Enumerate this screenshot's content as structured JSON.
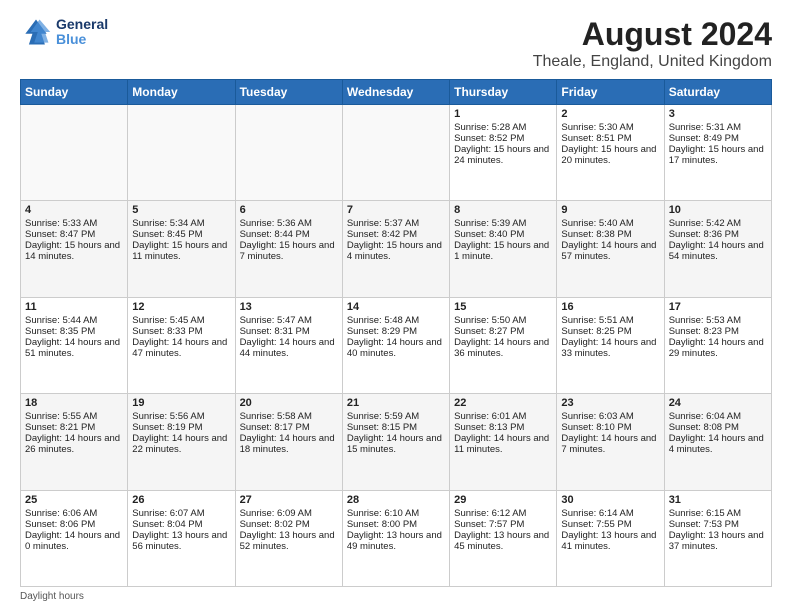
{
  "logo": {
    "line1": "General",
    "line2": "Blue"
  },
  "title": "August 2024",
  "subtitle": "Theale, England, United Kingdom",
  "days_of_week": [
    "Sunday",
    "Monday",
    "Tuesday",
    "Wednesday",
    "Thursday",
    "Friday",
    "Saturday"
  ],
  "footer": "Daylight hours",
  "weeks": [
    [
      {
        "day": "",
        "sunrise": "",
        "sunset": "",
        "daylight": ""
      },
      {
        "day": "",
        "sunrise": "",
        "sunset": "",
        "daylight": ""
      },
      {
        "day": "",
        "sunrise": "",
        "sunset": "",
        "daylight": ""
      },
      {
        "day": "",
        "sunrise": "",
        "sunset": "",
        "daylight": ""
      },
      {
        "day": "1",
        "sunrise": "Sunrise: 5:28 AM",
        "sunset": "Sunset: 8:52 PM",
        "daylight": "Daylight: 15 hours and 24 minutes."
      },
      {
        "day": "2",
        "sunrise": "Sunrise: 5:30 AM",
        "sunset": "Sunset: 8:51 PM",
        "daylight": "Daylight: 15 hours and 20 minutes."
      },
      {
        "day": "3",
        "sunrise": "Sunrise: 5:31 AM",
        "sunset": "Sunset: 8:49 PM",
        "daylight": "Daylight: 15 hours and 17 minutes."
      }
    ],
    [
      {
        "day": "4",
        "sunrise": "Sunrise: 5:33 AM",
        "sunset": "Sunset: 8:47 PM",
        "daylight": "Daylight: 15 hours and 14 minutes."
      },
      {
        "day": "5",
        "sunrise": "Sunrise: 5:34 AM",
        "sunset": "Sunset: 8:45 PM",
        "daylight": "Daylight: 15 hours and 11 minutes."
      },
      {
        "day": "6",
        "sunrise": "Sunrise: 5:36 AM",
        "sunset": "Sunset: 8:44 PM",
        "daylight": "Daylight: 15 hours and 7 minutes."
      },
      {
        "day": "7",
        "sunrise": "Sunrise: 5:37 AM",
        "sunset": "Sunset: 8:42 PM",
        "daylight": "Daylight: 15 hours and 4 minutes."
      },
      {
        "day": "8",
        "sunrise": "Sunrise: 5:39 AM",
        "sunset": "Sunset: 8:40 PM",
        "daylight": "Daylight: 15 hours and 1 minute."
      },
      {
        "day": "9",
        "sunrise": "Sunrise: 5:40 AM",
        "sunset": "Sunset: 8:38 PM",
        "daylight": "Daylight: 14 hours and 57 minutes."
      },
      {
        "day": "10",
        "sunrise": "Sunrise: 5:42 AM",
        "sunset": "Sunset: 8:36 PM",
        "daylight": "Daylight: 14 hours and 54 minutes."
      }
    ],
    [
      {
        "day": "11",
        "sunrise": "Sunrise: 5:44 AM",
        "sunset": "Sunset: 8:35 PM",
        "daylight": "Daylight: 14 hours and 51 minutes."
      },
      {
        "day": "12",
        "sunrise": "Sunrise: 5:45 AM",
        "sunset": "Sunset: 8:33 PM",
        "daylight": "Daylight: 14 hours and 47 minutes."
      },
      {
        "day": "13",
        "sunrise": "Sunrise: 5:47 AM",
        "sunset": "Sunset: 8:31 PM",
        "daylight": "Daylight: 14 hours and 44 minutes."
      },
      {
        "day": "14",
        "sunrise": "Sunrise: 5:48 AM",
        "sunset": "Sunset: 8:29 PM",
        "daylight": "Daylight: 14 hours and 40 minutes."
      },
      {
        "day": "15",
        "sunrise": "Sunrise: 5:50 AM",
        "sunset": "Sunset: 8:27 PM",
        "daylight": "Daylight: 14 hours and 36 minutes."
      },
      {
        "day": "16",
        "sunrise": "Sunrise: 5:51 AM",
        "sunset": "Sunset: 8:25 PM",
        "daylight": "Daylight: 14 hours and 33 minutes."
      },
      {
        "day": "17",
        "sunrise": "Sunrise: 5:53 AM",
        "sunset": "Sunset: 8:23 PM",
        "daylight": "Daylight: 14 hours and 29 minutes."
      }
    ],
    [
      {
        "day": "18",
        "sunrise": "Sunrise: 5:55 AM",
        "sunset": "Sunset: 8:21 PM",
        "daylight": "Daylight: 14 hours and 26 minutes."
      },
      {
        "day": "19",
        "sunrise": "Sunrise: 5:56 AM",
        "sunset": "Sunset: 8:19 PM",
        "daylight": "Daylight: 14 hours and 22 minutes."
      },
      {
        "day": "20",
        "sunrise": "Sunrise: 5:58 AM",
        "sunset": "Sunset: 8:17 PM",
        "daylight": "Daylight: 14 hours and 18 minutes."
      },
      {
        "day": "21",
        "sunrise": "Sunrise: 5:59 AM",
        "sunset": "Sunset: 8:15 PM",
        "daylight": "Daylight: 14 hours and 15 minutes."
      },
      {
        "day": "22",
        "sunrise": "Sunrise: 6:01 AM",
        "sunset": "Sunset: 8:13 PM",
        "daylight": "Daylight: 14 hours and 11 minutes."
      },
      {
        "day": "23",
        "sunrise": "Sunrise: 6:03 AM",
        "sunset": "Sunset: 8:10 PM",
        "daylight": "Daylight: 14 hours and 7 minutes."
      },
      {
        "day": "24",
        "sunrise": "Sunrise: 6:04 AM",
        "sunset": "Sunset: 8:08 PM",
        "daylight": "Daylight: 14 hours and 4 minutes."
      }
    ],
    [
      {
        "day": "25",
        "sunrise": "Sunrise: 6:06 AM",
        "sunset": "Sunset: 8:06 PM",
        "daylight": "Daylight: 14 hours and 0 minutes."
      },
      {
        "day": "26",
        "sunrise": "Sunrise: 6:07 AM",
        "sunset": "Sunset: 8:04 PM",
        "daylight": "Daylight: 13 hours and 56 minutes."
      },
      {
        "day": "27",
        "sunrise": "Sunrise: 6:09 AM",
        "sunset": "Sunset: 8:02 PM",
        "daylight": "Daylight: 13 hours and 52 minutes."
      },
      {
        "day": "28",
        "sunrise": "Sunrise: 6:10 AM",
        "sunset": "Sunset: 8:00 PM",
        "daylight": "Daylight: 13 hours and 49 minutes."
      },
      {
        "day": "29",
        "sunrise": "Sunrise: 6:12 AM",
        "sunset": "Sunset: 7:57 PM",
        "daylight": "Daylight: 13 hours and 45 minutes."
      },
      {
        "day": "30",
        "sunrise": "Sunrise: 6:14 AM",
        "sunset": "Sunset: 7:55 PM",
        "daylight": "Daylight: 13 hours and 41 minutes."
      },
      {
        "day": "31",
        "sunrise": "Sunrise: 6:15 AM",
        "sunset": "Sunset: 7:53 PM",
        "daylight": "Daylight: 13 hours and 37 minutes."
      }
    ]
  ]
}
